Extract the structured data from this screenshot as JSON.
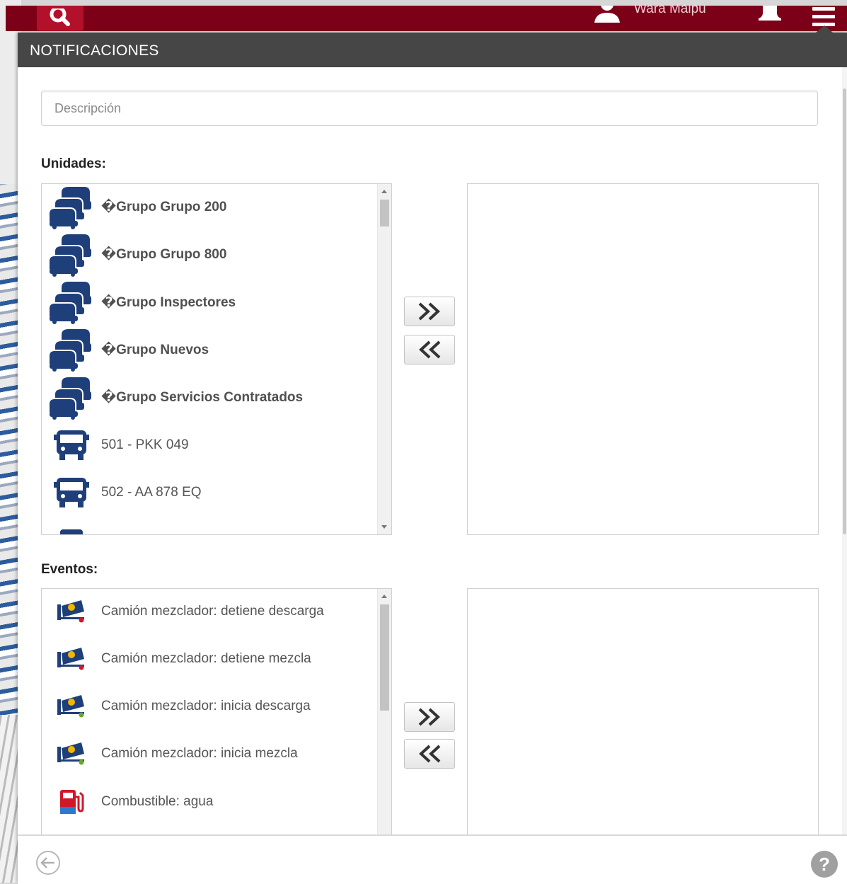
{
  "topbar": {
    "user_name": "Wara Maipu"
  },
  "panel": {
    "title": "NOTIFICACIONES"
  },
  "description": {
    "placeholder": "Descripción"
  },
  "units": {
    "label": "Unidades:",
    "items": [
      {
        "label": "�Grupo Grupo 200",
        "icon": "vehicle-group-icon"
      },
      {
        "label": "�Grupo Grupo 800",
        "icon": "vehicle-group-icon"
      },
      {
        "label": "�Grupo Inspectores",
        "icon": "vehicle-group-icon"
      },
      {
        "label": "�Grupo Nuevos",
        "icon": "vehicle-group-icon"
      },
      {
        "label": "�Grupo Servicios Contratados",
        "icon": "vehicle-group-icon"
      },
      {
        "label": "501 - PKK 049",
        "icon": "bus-icon"
      },
      {
        "label": "502 - AA 878 EQ",
        "icon": "bus-icon"
      }
    ]
  },
  "events": {
    "label": "Eventos:",
    "items": [
      {
        "label": "Camión mezclador: detiene descarga",
        "icon": "mixer-truck-icon",
        "dot_color": "#d0182a"
      },
      {
        "label": "Camión mezclador: detiene mezcla",
        "icon": "mixer-truck-icon",
        "dot_color": "#d0182a"
      },
      {
        "label": "Camión mezclador: inicia descarga",
        "icon": "mixer-truck-icon",
        "dot_color": "#6aa62a"
      },
      {
        "label": "Camión mezclador: inicia mezcla",
        "icon": "mixer-truck-icon",
        "dot_color": "#6aa62a"
      },
      {
        "label": "Combustible: agua",
        "icon": "fuel-pump-icon"
      }
    ]
  },
  "colors": {
    "brand": "#7d0019",
    "header": "#464646",
    "vehicle_blue": "#1f3f7a"
  }
}
